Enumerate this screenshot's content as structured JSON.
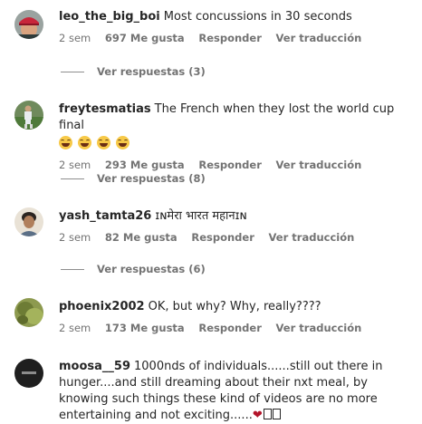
{
  "comments": [
    {
      "username": "leo_the_big_boi",
      "text": "Most concussions in 30 seconds",
      "time": "2 sem",
      "likes": "697 Me gusta",
      "reply": "Responder",
      "translate": "Ver traducción",
      "view_replies": "Ver respuestas (3)",
      "avatar_icon": "avatar-red-cap"
    },
    {
      "username": "freytesmatias",
      "text": "The French when they lost the world cup final",
      "emoji": [
        "face-with-tears-of-joy-icon",
        "face-with-tears-of-joy-icon",
        "face-with-tears-of-joy-icon",
        "face-with-tears-of-joy-icon"
      ],
      "time": "2 sem",
      "likes": "293 Me gusta",
      "reply": "Responder",
      "translate": "Ver traducción",
      "view_replies": "Ver respuestas (8)",
      "avatar_icon": "avatar-soccer-player"
    },
    {
      "username": "yash_tamta26",
      "text": "ɪɴमेरा भारत महानɪɴ",
      "time": "2 sem",
      "likes": "82 Me gusta",
      "reply": "Responder",
      "translate": "Ver traducción",
      "view_replies": "Ver respuestas (6)",
      "avatar_icon": "avatar-person-photo"
    },
    {
      "username": "phoenix2002",
      "text": "OK, but why? Why, really????",
      "time": "2 sem",
      "likes": "173 Me gusta",
      "reply": "Responder",
      "translate": "Ver traducción",
      "avatar_icon": "avatar-green-plant"
    },
    {
      "username": "moosa__59",
      "text": "1000nds of individuals......still out there in hunger....and still dreaming about their nxt meal, by knowing such things these kind of videos are no more entertaining and not exciting......",
      "time": "",
      "avatar_icon": "avatar-dark-logo"
    }
  ],
  "colors": {
    "text_primary": "#262626",
    "text_secondary": "#737373",
    "background": "#ffffff"
  }
}
